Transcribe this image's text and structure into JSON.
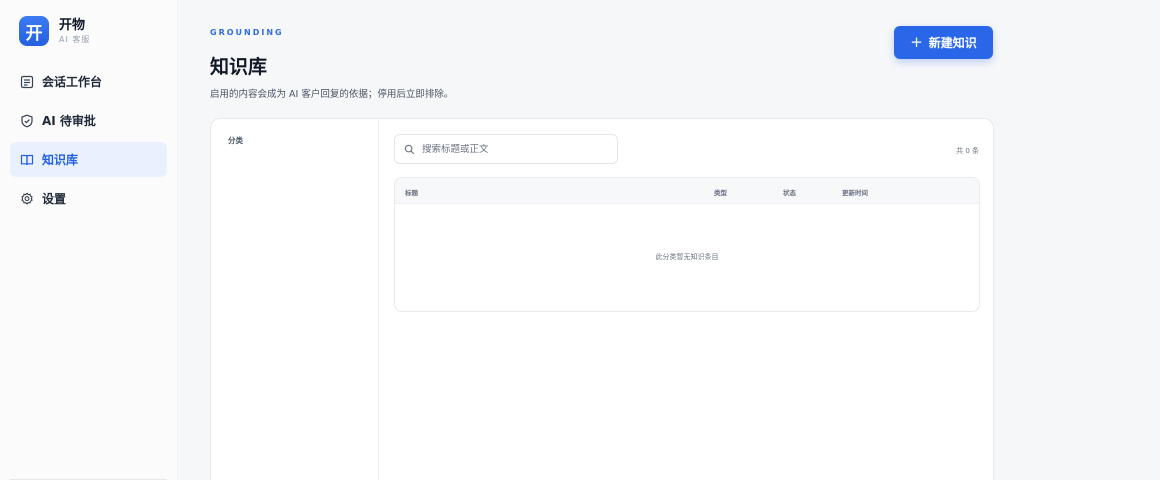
{
  "brand": {
    "logo_char": "开",
    "name": "开物",
    "subtitle": "AI 客服"
  },
  "sidebar": {
    "items": [
      {
        "label": "会话工作台",
        "icon": "chat-window-icon",
        "active": false
      },
      {
        "label": "AI 待审批",
        "icon": "shield-check-icon",
        "active": false
      },
      {
        "label": "知识库",
        "icon": "open-book-icon",
        "active": true
      },
      {
        "label": "设置",
        "icon": "gear-icon",
        "active": false
      }
    ]
  },
  "header": {
    "eyebrow": "GROUNDING",
    "title": "知识库",
    "description": "启用的内容会成为 AI 客户回复的依据；停用后立即排除。",
    "new_button": {
      "icon": "+",
      "label": "新建知识"
    }
  },
  "categories": {
    "title": "分类"
  },
  "search": {
    "placeholder": "搜索标题或正文",
    "value": ""
  },
  "count_text": "共 0 条",
  "table": {
    "columns": [
      "标题",
      "类型",
      "状态",
      "更新时间"
    ],
    "rows": [],
    "empty_text": "此分类暂无知识条目"
  },
  "colors": {
    "accent": "#2a67e8",
    "active_bg": "#eaf1fe",
    "active_text": "#2360df"
  }
}
